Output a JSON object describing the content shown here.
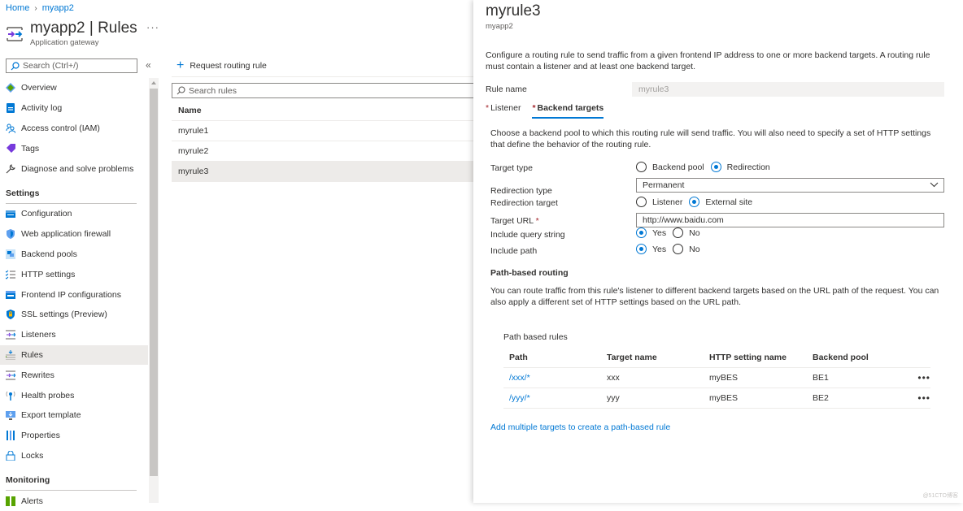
{
  "breadcrumb": {
    "home": "Home",
    "app": "myapp2"
  },
  "header": {
    "title": "myapp2 | Rules",
    "subtitle": "Application gateway",
    "more": "···"
  },
  "sidebar": {
    "search_placeholder": "Search (Ctrl+/)",
    "collapse": "«",
    "items_top": [
      {
        "label": "Overview",
        "icon": "overview-icon"
      },
      {
        "label": "Activity log",
        "icon": "activity-log-icon"
      },
      {
        "label": "Access control (IAM)",
        "icon": "iam-icon"
      },
      {
        "label": "Tags",
        "icon": "tag-icon"
      },
      {
        "label": "Diagnose and solve problems",
        "icon": "wrench-icon"
      }
    ],
    "settings_header": "Settings",
    "items_settings": [
      {
        "label": "Configuration",
        "icon": "configuration-icon"
      },
      {
        "label": "Web application firewall",
        "icon": "shield-icon"
      },
      {
        "label": "Backend pools",
        "icon": "backend-pools-icon"
      },
      {
        "label": "HTTP settings",
        "icon": "http-settings-icon"
      },
      {
        "label": "Frontend IP configurations",
        "icon": "frontend-ip-icon"
      },
      {
        "label": "SSL settings (Preview)",
        "icon": "ssl-shield-icon"
      },
      {
        "label": "Listeners",
        "icon": "listeners-icon"
      },
      {
        "label": "Rules",
        "icon": "rules-icon",
        "active": true
      },
      {
        "label": "Rewrites",
        "icon": "rewrites-icon"
      },
      {
        "label": "Health probes",
        "icon": "health-probe-icon"
      },
      {
        "label": "Export template",
        "icon": "export-template-icon"
      },
      {
        "label": "Properties",
        "icon": "properties-icon"
      },
      {
        "label": "Locks",
        "icon": "lock-icon"
      }
    ],
    "monitoring_header": "Monitoring",
    "items_monitoring": [
      {
        "label": "Alerts",
        "icon": "alerts-icon"
      }
    ]
  },
  "rules_list": {
    "add_label": "Request routing rule",
    "search_placeholder": "Search rules",
    "column": "Name",
    "rows": [
      "myrule1",
      "myrule2",
      "myrule3"
    ],
    "selected": "myrule3"
  },
  "panel": {
    "title": "myrule3",
    "subtitle": "myapp2",
    "description": "Configure a routing rule to send traffic from a given frontend IP address to one or more backend targets. A routing rule must contain a listener and at least one backend target.",
    "rule_name_label": "Rule name",
    "rule_name_value": "myrule3",
    "tabs": [
      {
        "label": "Listener",
        "required": "*"
      },
      {
        "label": "Backend targets",
        "required": "*",
        "active": true
      }
    ],
    "backend_desc": "Choose a backend pool to which this routing rule will send traffic. You will also need to specify a set of HTTP settings that define the behavior of the routing rule.",
    "target_type": {
      "label": "Target type",
      "options": [
        "Backend pool",
        "Redirection"
      ],
      "selected": "Redirection"
    },
    "redirection_type": {
      "label": "Redirection type",
      "value": "Permanent"
    },
    "redirection_target": {
      "label": "Redirection target",
      "options": [
        "Listener",
        "External site"
      ],
      "selected": "External site"
    },
    "target_url": {
      "label": "Target URL",
      "required": "*",
      "value": "http://www.baidu.com"
    },
    "include_query": {
      "label": "Include query string",
      "options": [
        "Yes",
        "No"
      ],
      "selected": "Yes"
    },
    "include_path": {
      "label": "Include path",
      "options": [
        "Yes",
        "No"
      ],
      "selected": "Yes"
    },
    "path_routing_header": "Path-based routing",
    "path_routing_desc": "You can route traffic from this rule's listener to different backend targets based on the URL path of the request. You can also apply a different set of HTTP settings based on the URL path.",
    "path_rules_title": "Path based rules",
    "path_columns": [
      "Path",
      "Target name",
      "HTTP setting name",
      "Backend pool"
    ],
    "path_rows": [
      {
        "path": "/xxx/*",
        "target": "xxx",
        "http": "myBES",
        "pool": "BE1",
        "more": "•••"
      },
      {
        "path": "/yyy/*",
        "target": "yyy",
        "http": "myBES",
        "pool": "BE2",
        "more": "•••"
      }
    ],
    "add_link": "Add multiple targets to create a path-based rule"
  },
  "watermark": "@51CTO博客"
}
